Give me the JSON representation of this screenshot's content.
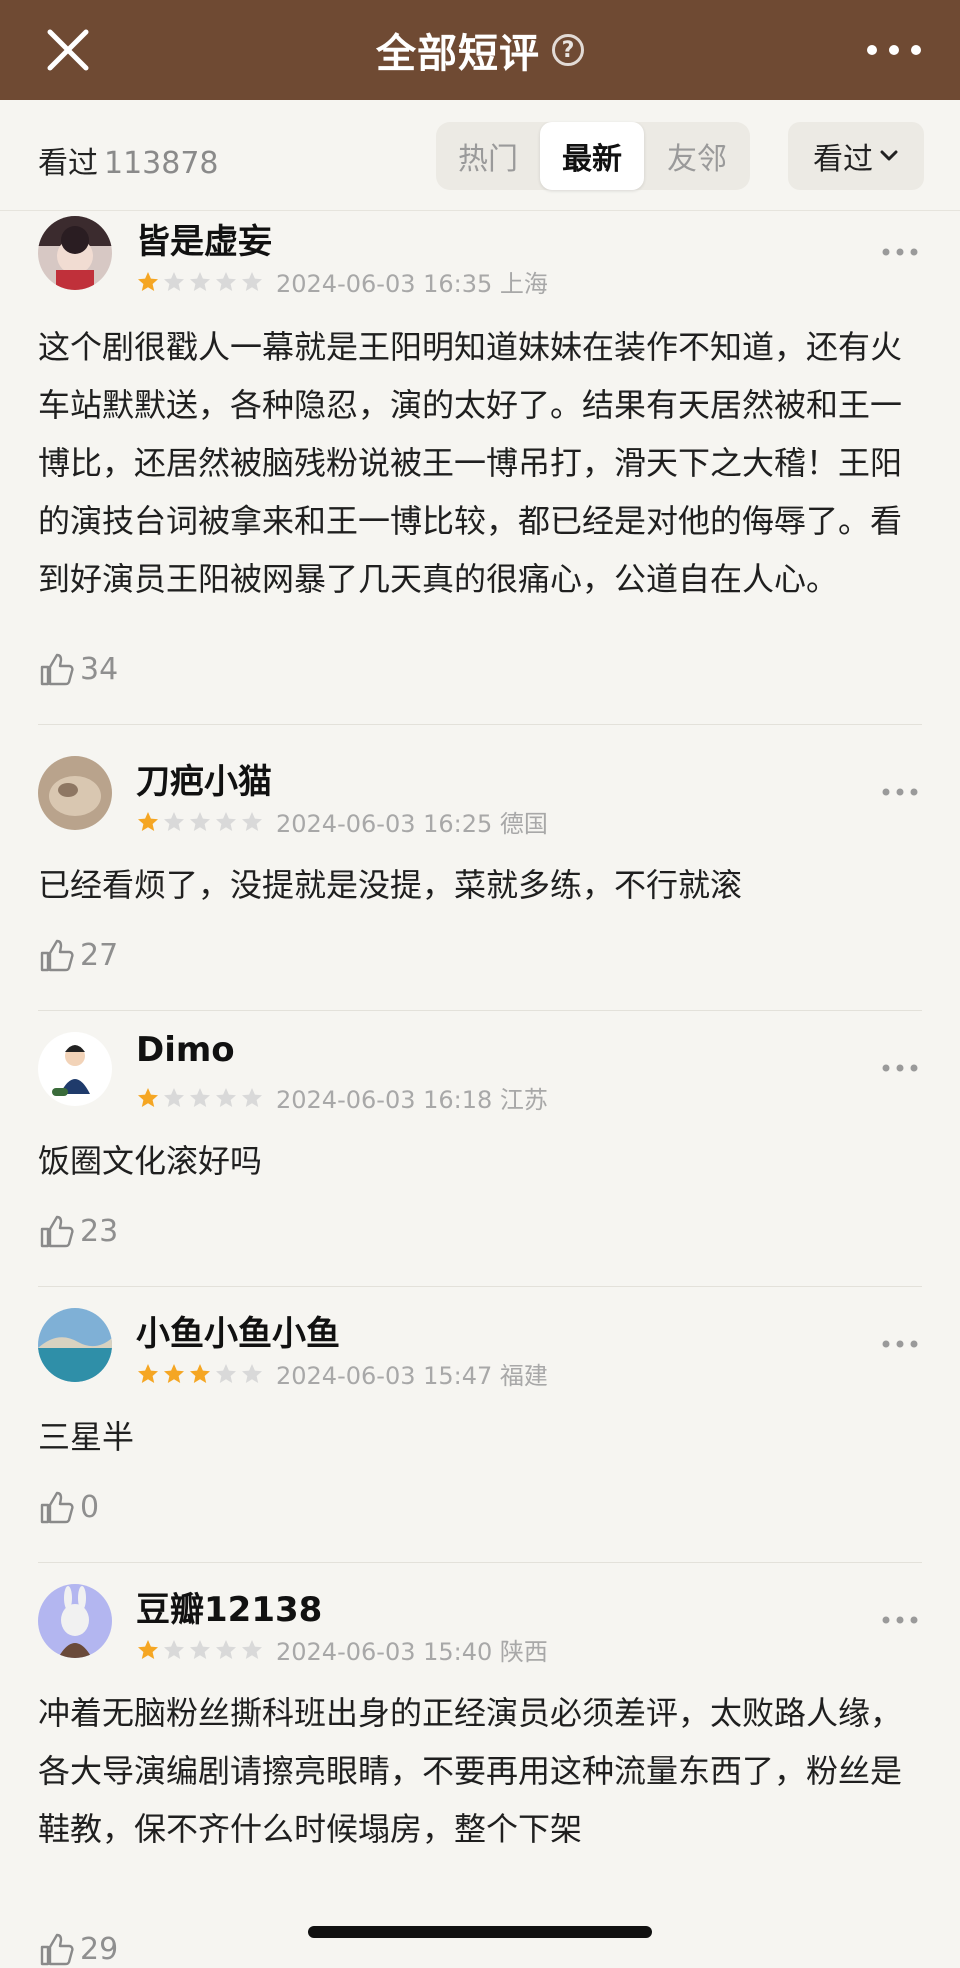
{
  "header": {
    "title": "全部短评",
    "help_icon": "question-circle-icon",
    "close_icon": "close-icon",
    "more_icon": "more-horizontal-icon"
  },
  "filter": {
    "seen_label": "看过",
    "seen_count": "113878",
    "tabs": [
      "热门",
      "最新",
      "友邻"
    ],
    "active_tab": "最新",
    "dropdown_label": "看过"
  },
  "colors": {
    "header_bg": "#6f4a33",
    "star_active": "#f5a623",
    "star_inactive": "#d9d9d9"
  },
  "comments": [
    {
      "username": "皆是虚妄",
      "rating": 1,
      "time": "2024-06-03 16:35 上海",
      "text": "这个剧很戳人一幕就是王阳明知道妹妹在装作不知道，还有火车站默默送，各种隐忍，演的太好了。结果有天居然被和王一博比，还居然被脑残粉说被王一博吊打，滑天下之大稽！王阳的演技台词被拿来和王一博比较，都已经是对他的侮辱了。看到好演员王阳被网暴了几天真的很痛心，公道自在人心。",
      "likes": "34"
    },
    {
      "username": "刀疤小猫",
      "rating": 1,
      "time": "2024-06-03 16:25 德国",
      "text": "已经看烦了，没提就是没提，菜就多练，不行就滚",
      "likes": "27"
    },
    {
      "username": "Dimo",
      "rating": 1,
      "time": "2024-06-03 16:18 江苏",
      "text": "饭圈文化滚好吗",
      "likes": "23"
    },
    {
      "username": "小鱼小鱼小鱼",
      "rating": 3,
      "time": "2024-06-03 15:47 福建",
      "text": "三星半",
      "likes": "0"
    },
    {
      "username": "豆瓣12138",
      "rating": 1,
      "time": "2024-06-03 15:40 陕西",
      "text": "冲着无脑粉丝撕科班出身的正经演员必须差评，太败路人缘，各大导演编剧请擦亮眼睛，不要再用这种流量东西了，粉丝是鞋教，保不齐什么时候塌房，整个下架",
      "likes": "29"
    }
  ]
}
